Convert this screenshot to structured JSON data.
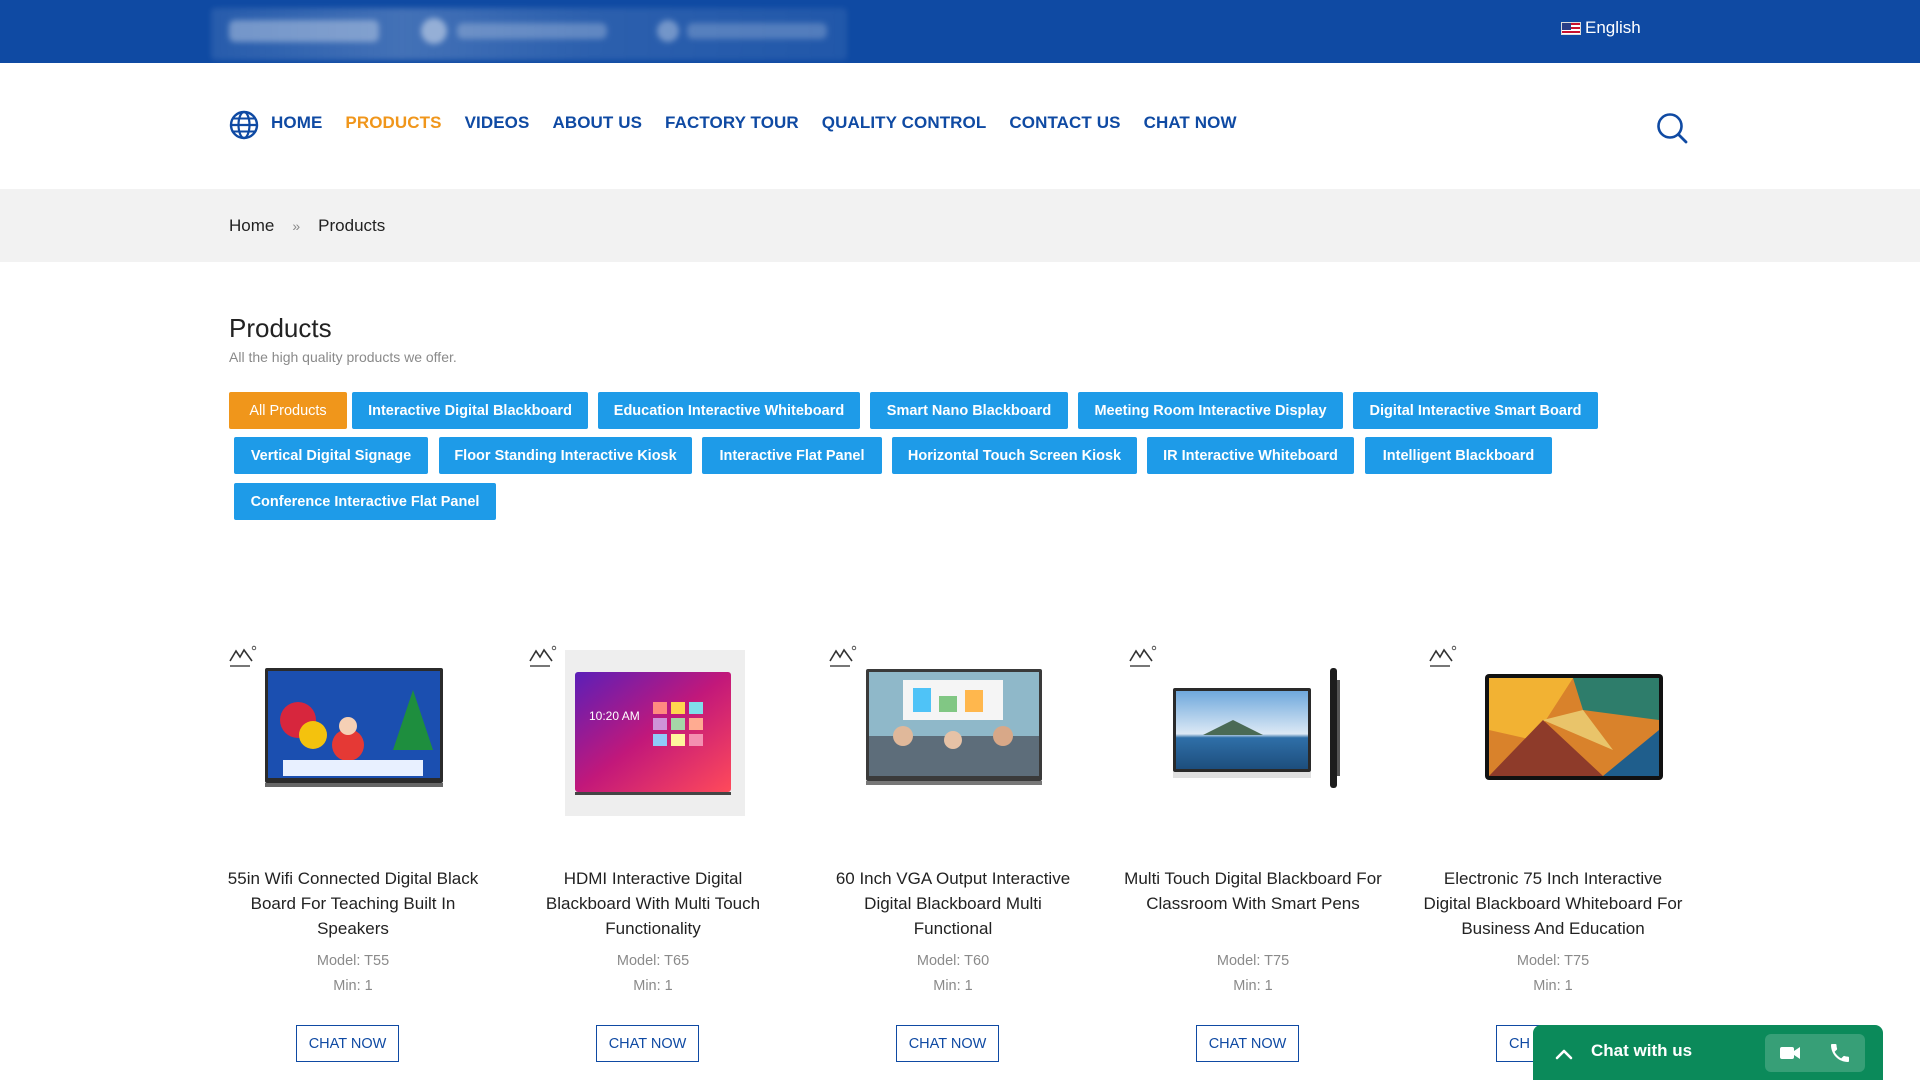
{
  "topbar": {
    "language": "English"
  },
  "nav": {
    "items": [
      {
        "label": "HOME",
        "active": false
      },
      {
        "label": "PRODUCTS",
        "active": true
      },
      {
        "label": "VIDEOS",
        "active": false
      },
      {
        "label": "ABOUT US",
        "active": false
      },
      {
        "label": "FACTORY TOUR",
        "active": false
      },
      {
        "label": "QUALITY CONTROL",
        "active": false
      },
      {
        "label": "CONTACT US",
        "active": false
      },
      {
        "label": "CHAT NOW",
        "active": false
      }
    ]
  },
  "breadcrumb": {
    "home": "Home",
    "separator": "»",
    "current": "Products"
  },
  "products_section": {
    "title": "Products",
    "subtitle": "All the high quality products we offer.",
    "categories": [
      "All Products",
      "Interactive Digital Blackboard",
      "Education Interactive Whiteboard",
      "Smart Nano Blackboard",
      "Meeting Room Interactive Display",
      "Digital Interactive Smart Board",
      "Vertical Digital Signage",
      "Floor Standing Interactive Kiosk",
      "Interactive Flat Panel",
      "Horizontal Touch Screen Kiosk",
      "IR Interactive Whiteboard",
      "Intelligent Blackboard",
      "Conference Interactive Flat Panel"
    ]
  },
  "products": [
    {
      "name": "55in Wifi Connected Digital Black Board For Teaching Built In Speakers",
      "model": "Model: T55",
      "min": "Min: 1",
      "button": "CHAT NOW"
    },
    {
      "name": "HDMI Interactive Digital Blackboard With Multi Touch Functionality",
      "model": "Model: T65",
      "min": "Min: 1",
      "button": "CHAT NOW",
      "screen_time": "10:20 AM"
    },
    {
      "name": "60 Inch VGA Output Interactive Digital Blackboard Multi Functional",
      "model": "Model: T60",
      "min": "Min: 1",
      "button": "CHAT NOW"
    },
    {
      "name": "Multi Touch Digital Blackboard For Classroom With Smart Pens",
      "model": "Model: T75",
      "min": "Min: 1",
      "button": "CHAT NOW"
    },
    {
      "name": "Electronic 75 Inch Interactive Digital Blackboard Whiteboard For Business And Education",
      "model": "Model: T75",
      "min": "Min: 1",
      "button": "CH"
    }
  ],
  "chat_widget": {
    "label": "Chat with us"
  },
  "colors": {
    "brand_blue": "#0f4aa3",
    "chip_blue": "#1e9be8",
    "accent_orange": "#f0961b",
    "chat_green": "#0b8a5a"
  }
}
